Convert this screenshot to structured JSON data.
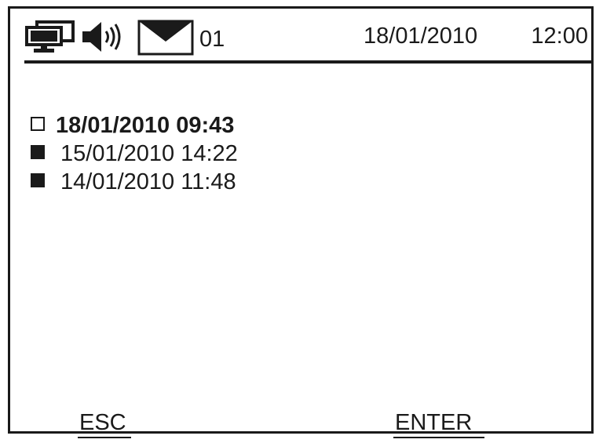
{
  "status_bar": {
    "icons": [
      "network-icon",
      "speaker-icon",
      "envelope-icon"
    ],
    "message_count": "01",
    "date": "18/01/2010",
    "time": "12:00"
  },
  "messages": [
    {
      "datetime": "18/01/2010 09:43",
      "read": false,
      "selected": true
    },
    {
      "datetime": "15/01/2010 14:22",
      "read": true,
      "selected": false
    },
    {
      "datetime": "14/01/2010 11:48",
      "read": true,
      "selected": false
    }
  ],
  "softkeys": {
    "left_label": "ESC",
    "right_label": "ENTER"
  }
}
